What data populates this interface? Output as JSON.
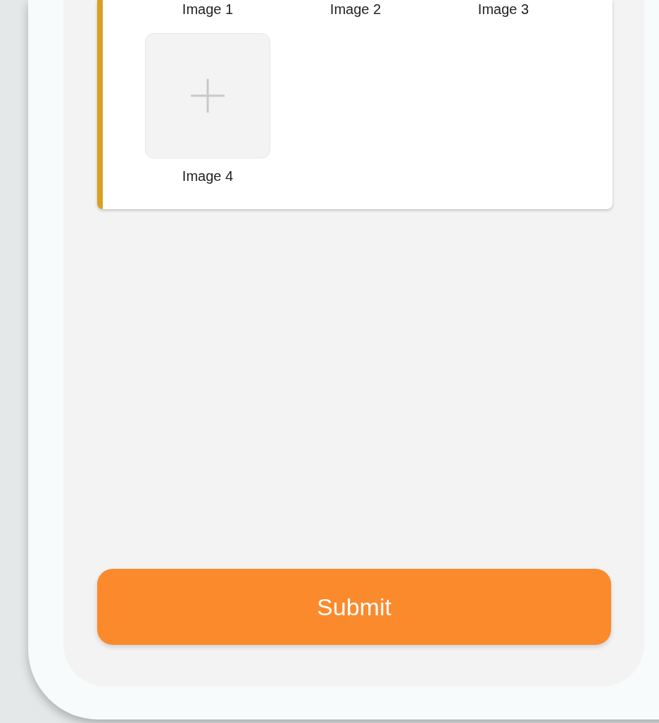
{
  "images": [
    {
      "label": "Image 1",
      "kind": "label_only"
    },
    {
      "label": "Image 2",
      "kind": "label_only"
    },
    {
      "label": "Image 3",
      "kind": "label_only"
    },
    {
      "label": "Image 4",
      "kind": "add_tile"
    }
  ],
  "submit_button": {
    "label": "Submit"
  }
}
